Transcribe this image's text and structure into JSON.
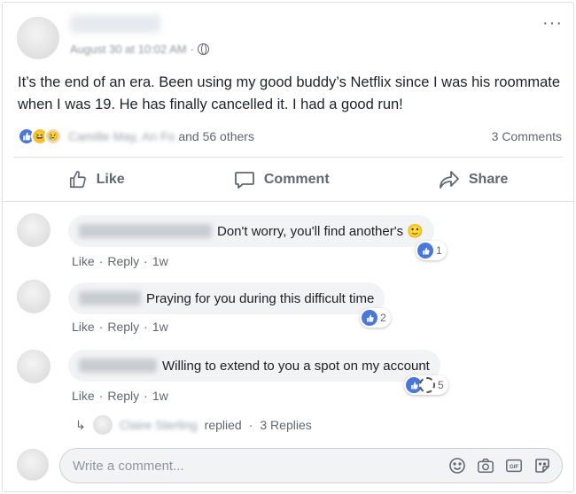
{
  "post": {
    "date": "August 30 at 10:02 AM",
    "separator": "·",
    "text": "It’s the end of an era. Been using my good buddy’s Netflix since I was his roommate when I was 19. He has finally cancelled it. I had a good run!",
    "reactions": {
      "names_blurred": "Camille May, An Fo",
      "others": "and 56 others",
      "comments_count": "3 Comments",
      "icons": [
        "like-icon",
        "haha-icon",
        "sad-icon"
      ]
    },
    "actions": {
      "like": "Like",
      "comment": "Comment",
      "share": "Share"
    }
  },
  "comments": [
    {
      "text": "Don't worry, you'll find another's",
      "emoji": "🙂",
      "reaction_count": "1",
      "like": "Like",
      "reply": "Reply",
      "time": "1w"
    },
    {
      "text": "Praying for you during this difficult time",
      "reaction_count": "2",
      "like": "Like",
      "reply": "Reply",
      "time": "1w"
    },
    {
      "text": "Willing to extend to you a spot on my account",
      "reaction_count": "5",
      "like": "Like",
      "reply": "Reply",
      "time": "1w"
    }
  ],
  "replies": {
    "names_blurred": "Claire Sterling",
    "replied": "replied",
    "count": "3 Replies"
  },
  "composer": {
    "placeholder": "Write a comment..."
  },
  "colors": {
    "accent": "#4a78d8",
    "muted": "#606770",
    "bubble": "#f2f3f5"
  }
}
